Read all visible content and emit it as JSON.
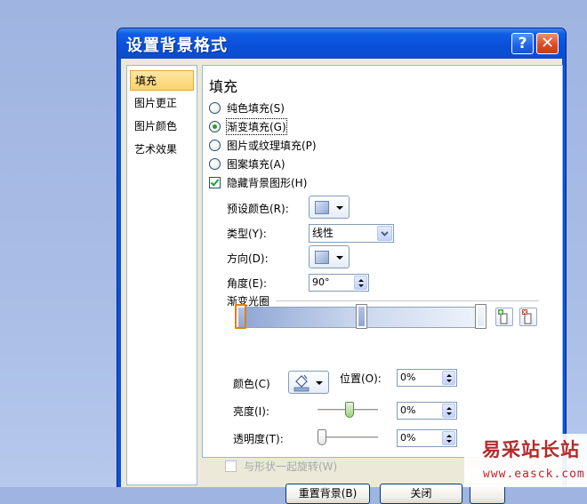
{
  "dialog": {
    "title": "设置背景格式",
    "help_glyph": "?",
    "close_glyph": "✕"
  },
  "nav": {
    "items": [
      {
        "label": "填充",
        "active": true
      },
      {
        "label": "图片更正",
        "active": false
      },
      {
        "label": "图片颜色",
        "active": false
      },
      {
        "label": "艺术效果",
        "active": false
      }
    ]
  },
  "fill": {
    "heading": "填充",
    "options": [
      {
        "label": "纯色填充(S)",
        "selected": false
      },
      {
        "label": "渐变填充(G)",
        "selected": true
      },
      {
        "label": "图片或纹理填充(P)",
        "selected": false
      },
      {
        "label": "图案填充(A)",
        "selected": false
      }
    ],
    "hide_bg_shapes": {
      "label": "隐藏背景图形(H)",
      "checked": true
    },
    "preset_colors_label": "预设颜色(R):",
    "type_label": "类型(Y):",
    "type_value": "线性",
    "direction_label": "方向(D):",
    "angle_label": "角度(E):",
    "angle_value": "90°",
    "gradient_stops_label": "渐变光圈",
    "color_label": "颜色(C)",
    "position_label": "位置(O):",
    "position_value": "0%",
    "brightness_label": "亮度(I):",
    "brightness_value": "0%",
    "transparency_label": "透明度(T):",
    "transparency_value": "0%",
    "rotate_with_shape": {
      "label": "与形状一起旋转(W)",
      "checked": false
    }
  },
  "footer": {
    "reset_label": "重置背景(B)",
    "close_label": "关闭"
  },
  "watermark": {
    "title": "易采站长站",
    "url": "www.easck.com"
  },
  "colors": {
    "titlebar": "#0a51d8",
    "dialog_bg": "#ece9d8",
    "watermark": "#b52a2a"
  }
}
